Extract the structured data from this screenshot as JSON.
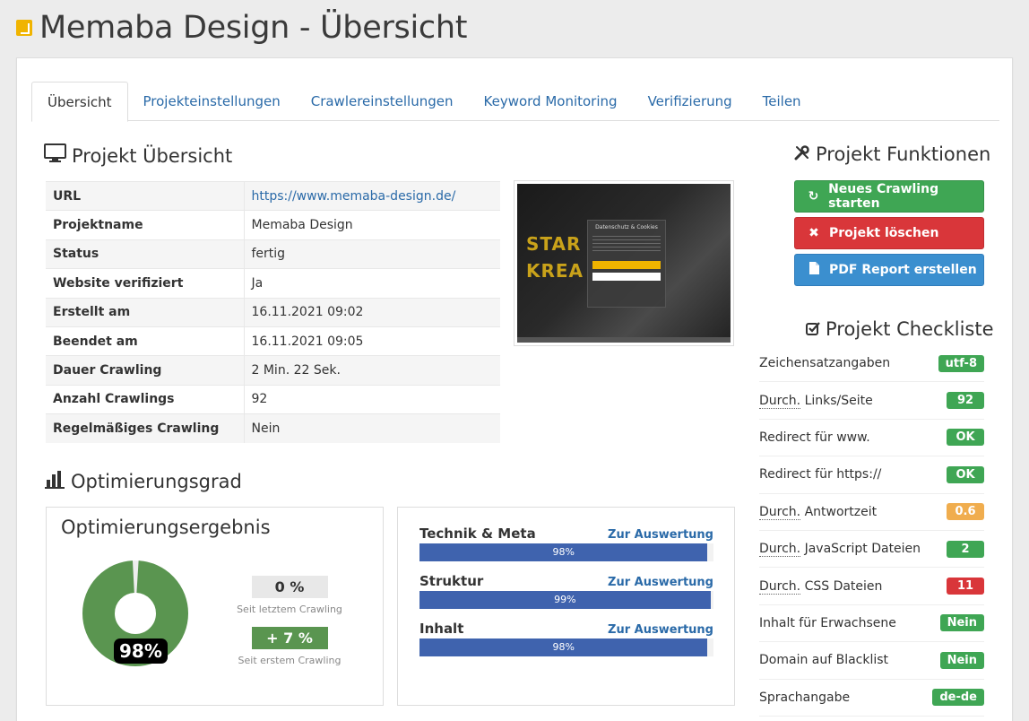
{
  "header": {
    "title": "Memaba Design - Übersicht"
  },
  "tabs": [
    {
      "label": "Übersicht",
      "active": true
    },
    {
      "label": "Projekteinstellungen"
    },
    {
      "label": "Crawlereinstellungen"
    },
    {
      "label": "Keyword Monitoring"
    },
    {
      "label": "Verifizierung"
    },
    {
      "label": "Teilen"
    }
  ],
  "overview": {
    "title": "Projekt Übersicht",
    "rows": [
      {
        "key": "URL",
        "value": "https://www.memaba-design.de/"
      },
      {
        "key": "Projektname",
        "value": "Memaba Design"
      },
      {
        "key": "Status",
        "value": "fertig"
      },
      {
        "key": "Website verifiziert",
        "value": "Ja"
      },
      {
        "key": "Erstellt am",
        "value": "16.11.2021 09:02"
      },
      {
        "key": "Beendet am",
        "value": "16.11.2021 09:05"
      },
      {
        "key": "Dauer Crawling",
        "value": "2 Min. 22 Sek."
      },
      {
        "key": "Anzahl Crawlings",
        "value": "92"
      },
      {
        "key": "Regelmäßiges Crawling",
        "value": "Nein"
      }
    ],
    "screenshot_text": "STAR KREA",
    "screenshot_dialog_title": "Datenschutz & Cookies"
  },
  "optimization": {
    "title": "Optimierungsgrad",
    "result_title": "Optimierungsergebnis",
    "score": "98%",
    "score_fraction": 0.98,
    "since_last": {
      "value": "0 %",
      "label": "Seit letztem Crawling"
    },
    "since_first": {
      "value": "+ 7 %",
      "label": "Seit erstem Crawling"
    },
    "categories": [
      {
        "name": "Technik & Meta",
        "link": "Zur Auswertung",
        "percent": 98,
        "label": "98%"
      },
      {
        "name": "Struktur",
        "link": "Zur Auswertung",
        "percent": 99,
        "label": "99%"
      },
      {
        "name": "Inhalt",
        "link": "Zur Auswertung",
        "percent": 98,
        "label": "98%"
      }
    ]
  },
  "functions": {
    "title": "Projekt Funktionen",
    "buttons": {
      "crawl": "Neues Crawling starten",
      "delete": "Projekt löschen",
      "pdf": "PDF Report erstellen"
    }
  },
  "checklist": {
    "title": "Projekt Checkliste",
    "items": [
      {
        "label": "Zeichensatzangaben",
        "value": "utf-8",
        "status": "green"
      },
      {
        "prefix": "Durch.",
        "label": " Links/Seite",
        "value": "92",
        "status": "green"
      },
      {
        "label": "Redirect für www.",
        "value": "OK",
        "status": "green"
      },
      {
        "label": "Redirect für https://",
        "value": "OK",
        "status": "green"
      },
      {
        "prefix": "Durch.",
        "label": " Antwortzeit",
        "value": "0.6",
        "status": "orange"
      },
      {
        "prefix": "Durch.",
        "label": " JavaScript Dateien",
        "value": "2",
        "status": "green"
      },
      {
        "prefix": "Durch.",
        "label": " CSS Dateien",
        "value": "11",
        "status": "red"
      },
      {
        "label": "Inhalt für Erwachsene",
        "value": "Nein",
        "status": "green"
      },
      {
        "label": "Domain auf Blacklist",
        "value": "Nein",
        "status": "green"
      },
      {
        "label": "Sprachangabe",
        "value": "de-de",
        "status": "green"
      }
    ]
  },
  "colors": {
    "link": "#2a6aa8",
    "green": "#3fa654",
    "red": "#d9363a",
    "blue": "#3b8fcf",
    "orange": "#f0ad4e",
    "donut": "#5a9550",
    "bar": "#3f63ae"
  }
}
